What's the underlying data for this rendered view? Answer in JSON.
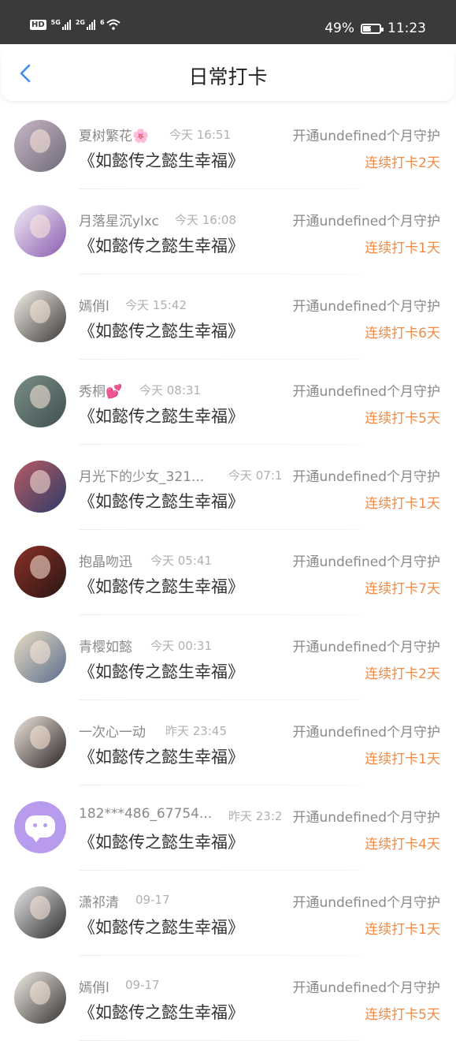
{
  "status_bar": {
    "hd_label": "HD",
    "net1": "5G",
    "net2": "2G",
    "net3": "6",
    "battery_text": "49%",
    "battery_level": 0.49,
    "time": "11:23"
  },
  "header": {
    "title": "日常打卡"
  },
  "checkins": [
    {
      "name": "夏树繁花🌸",
      "time": "今天 16:51",
      "guard": "开通undefined个月守护",
      "drama": "《如懿传之懿生幸福》",
      "streak": "连续打卡2天"
    },
    {
      "name": "月落星沉ylxc",
      "time": "今天 16:08",
      "guard": "开通undefined个月守护",
      "drama": "《如懿传之懿生幸福》",
      "streak": "连续打卡1天"
    },
    {
      "name": "嫣俏l",
      "time": "今天 15:42",
      "guard": "开通undefined个月守护",
      "drama": "《如懿传之懿生幸福》",
      "streak": "连续打卡6天"
    },
    {
      "name": "秀桐💕",
      "time": "今天 08:31",
      "guard": "开通undefined个月守护",
      "drama": "《如懿传之懿生幸福》",
      "streak": "连续打卡5天"
    },
    {
      "name": "月光下的少女_321...",
      "time": "今天 07:1",
      "guard": "开通undefined个月守护",
      "drama": "《如懿传之懿生幸福》",
      "streak": "连续打卡1天"
    },
    {
      "name": "抱晶吻迅",
      "time": "今天 05:41",
      "guard": "开通undefined个月守护",
      "drama": "《如懿传之懿生幸福》",
      "streak": "连续打卡7天"
    },
    {
      "name": "青樱如懿",
      "time": "今天 00:31",
      "guard": "开通undefined个月守护",
      "drama": "《如懿传之懿生幸福》",
      "streak": "连续打卡2天"
    },
    {
      "name": "一次心一动",
      "time": "昨天 23:45",
      "guard": "开通undefined个月守护",
      "drama": "《如懿传之懿生幸福》",
      "streak": "连续打卡1天"
    },
    {
      "name": "182***486_67754...",
      "time": "昨天 23:2",
      "guard": "开通undefined个月守护",
      "drama": "《如懿传之懿生幸福》",
      "streak": "连续打卡4天"
    },
    {
      "name": "潇祁清",
      "time": "09-17",
      "guard": "开通undefined个月守护",
      "drama": "《如懿传之懿生幸福》",
      "streak": "连续打卡1天"
    },
    {
      "name": "嫣俏l",
      "time": "09-17",
      "guard": "开通undefined个月守护",
      "drama": "《如懿传之懿生幸福》",
      "streak": "连续打卡5天"
    }
  ]
}
